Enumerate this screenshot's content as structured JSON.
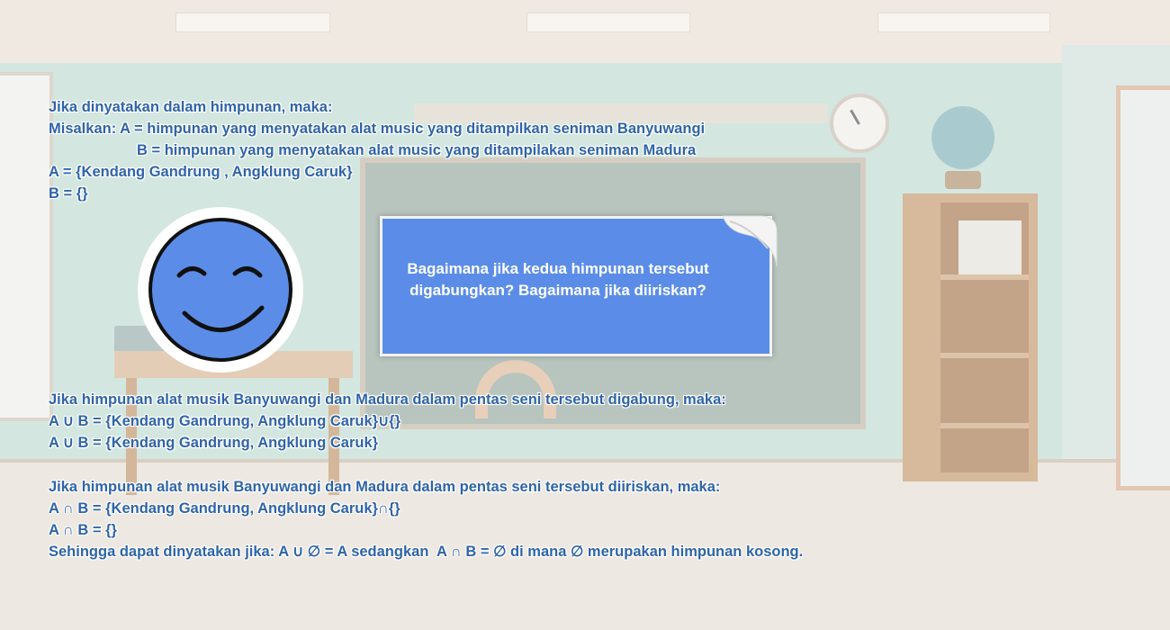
{
  "intro": {
    "line1": "Jika dinyatakan dalam himpunan, maka:",
    "line2": "Misalkan: A = himpunan yang menyatakan alat music yang ditampilkan seniman Banyuwangi",
    "line3": "B = himpunan yang menyatakan alat music yang ditampilakan seniman Madura",
    "line4": "A = {Kendang Gandrung , Angklung Caruk}",
    "line5": "B = {}"
  },
  "question": {
    "text": "Bagaimana jika kedua himpunan tersebut digabungkan? Bagaimana jika diiriskan?"
  },
  "union": {
    "line1": "Jika himpunan alat musik Banyuwangi dan Madura dalam pentas seni tersebut digabung, maka:",
    "line2": "A ∪ B = {Kendang Gandrung, Angklung Caruk}∪{}",
    "line3": "A ∪ B = {Kendang Gandrung, Angklung Caruk}"
  },
  "intersection": {
    "line1": "Jika himpunan alat musik Banyuwangi dan Madura dalam pentas seni tersebut diiriskan, maka:",
    "line2": "A ∩ B = {Kendang Gandrung, Angklung Caruk}∩{}",
    "line3": "A ∩ B = {}",
    "line4": "Sehingga dapat dinyatakan jika: A ∪ ∅ = A sedangkan  A ∩ B = ∅ di mana ∅ merupakan himpunan kosong."
  },
  "icons": {
    "smiley": "smiley-face-icon",
    "note": "paper-note-curl"
  },
  "colors": {
    "text": "#2f64a8",
    "note_fill": "#5b8de8",
    "smiley_fill": "#5b8de8"
  }
}
